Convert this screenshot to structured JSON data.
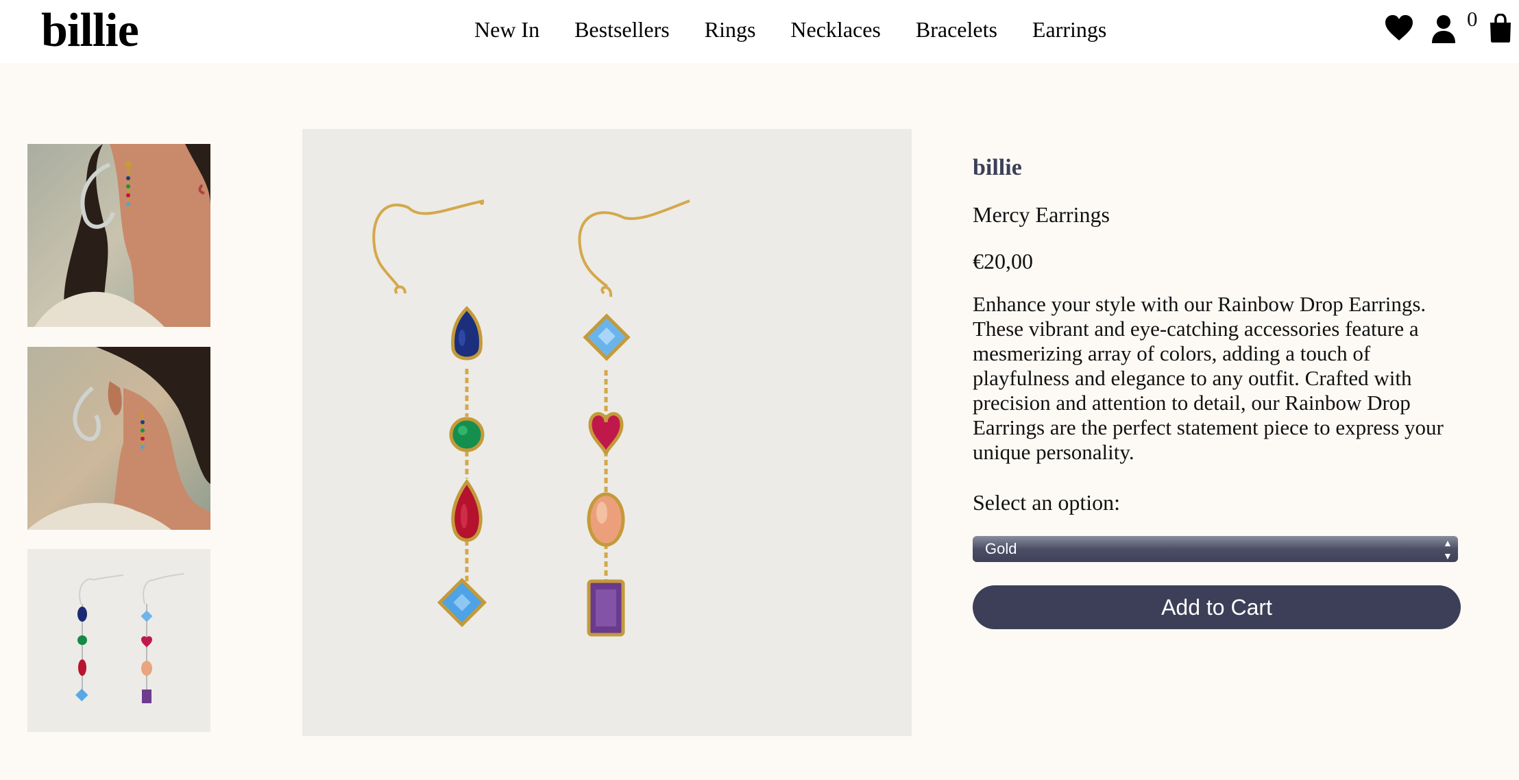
{
  "header": {
    "logo": "billie",
    "nav": [
      "New In",
      "Bestsellers",
      "Rings",
      "Necklaces",
      "Bracelets",
      "Earrings"
    ],
    "icons": [
      "heart-icon",
      "user-icon",
      "bag-icon"
    ],
    "cart_count": "0"
  },
  "product": {
    "brand": "billie",
    "name": "Mercy Earrings",
    "price": "€20,00",
    "description": "Enhance your style with our Rainbow Drop Earrings. These vibrant and eye-catching accessories feature a mesmerizing array of colors, adding a touch of playfulness and elegance to any outfit. Crafted with precision and attention to detail, our Rainbow Drop Earrings are the perfect statement piece to express your unique personality.",
    "option_label": "Select an option:",
    "option_selected": "Gold",
    "add_to_cart": "Add to Cart"
  },
  "colors": {
    "background": "#fdfaf5",
    "header": "#ffffff",
    "accent": "#3c3f57",
    "image_bg": "#ecebe7"
  }
}
